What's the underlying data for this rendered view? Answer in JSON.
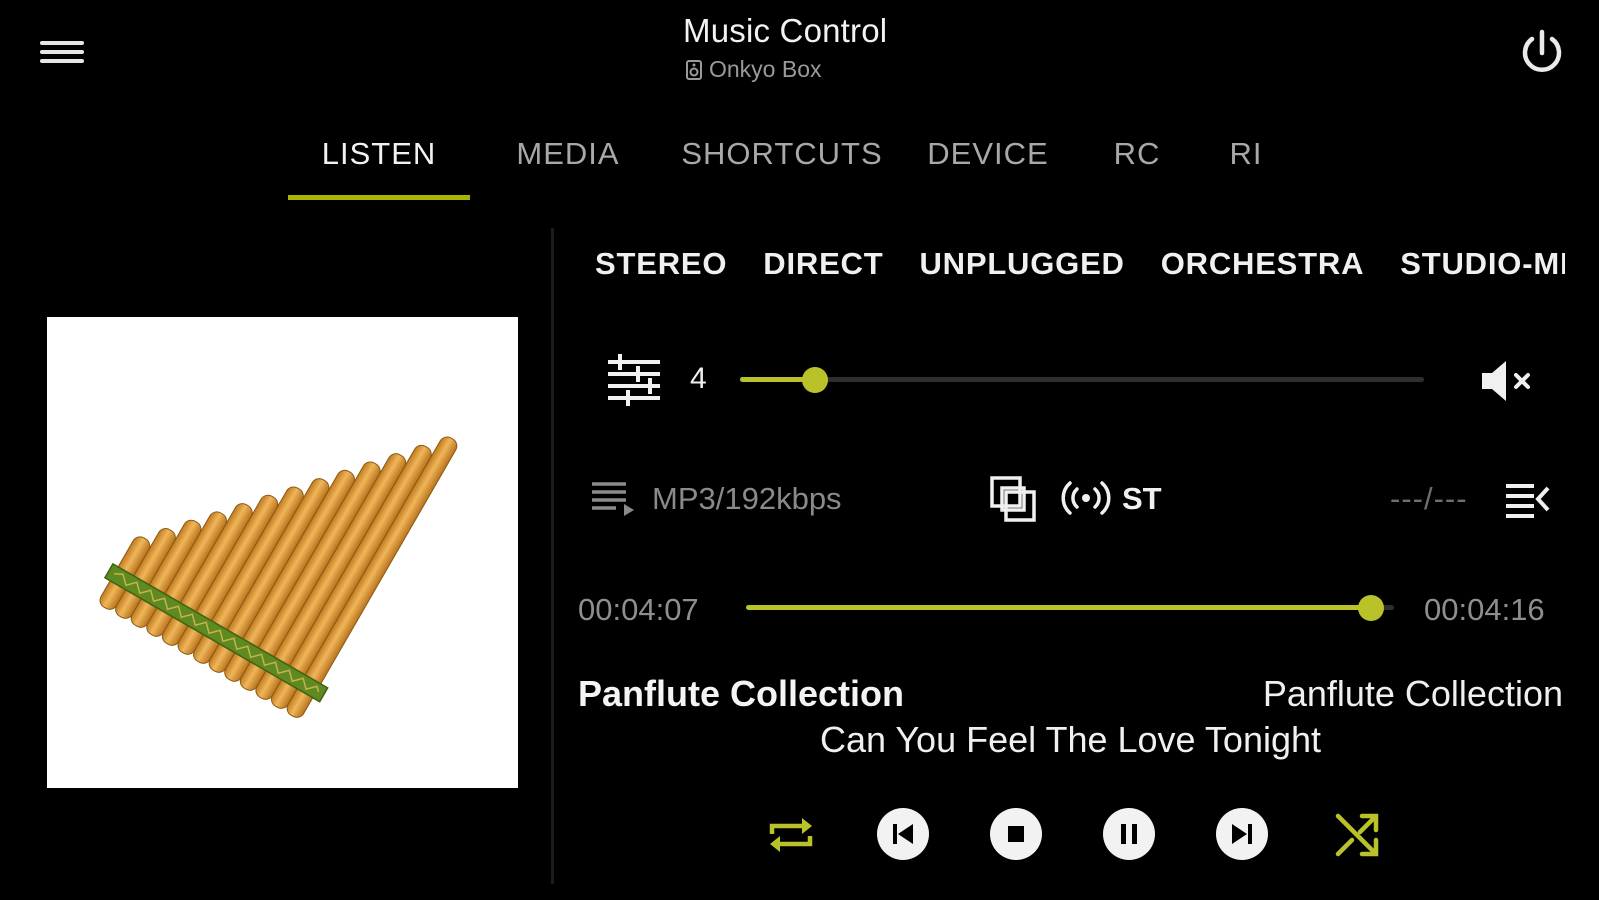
{
  "header": {
    "title": "Music Control",
    "device": "Onkyo Box"
  },
  "tabs": [
    {
      "label": "LISTEN",
      "active": true
    },
    {
      "label": "MEDIA",
      "active": false
    },
    {
      "label": "SHORTCUTS",
      "active": false
    },
    {
      "label": "DEVICE",
      "active": false
    },
    {
      "label": "RC",
      "active": false
    },
    {
      "label": "RI",
      "active": false
    }
  ],
  "listening_modes": [
    "STEREO",
    "DIRECT",
    "UNPLUGGED",
    "ORCHESTRA",
    "STUDIO-MI"
  ],
  "volume": {
    "value": "4",
    "level_fraction": 0.11,
    "muted": false
  },
  "info": {
    "format": "MP3/192kbps",
    "signal": "ST",
    "track_position": "---/---"
  },
  "playback": {
    "elapsed": "00:04:07",
    "total": "00:04:16",
    "progress_fraction": 0.965
  },
  "track": {
    "album": "Panflute Collection",
    "artist": "Panflute Collection",
    "title": "Can You Feel The Love Tonight"
  },
  "icons": {
    "menu": "menu-icon",
    "power": "power-icon",
    "equalizer": "equalizer-icon",
    "mute": "volume-mute-icon",
    "playlist": "playlist-icon",
    "fit": "screen-fit-icon",
    "radio": "radio-signal-icon",
    "queue": "queue-icon",
    "repeat": "repeat-icon",
    "previous": "skip-previous-icon",
    "stop": "stop-icon",
    "pause": "pause-icon",
    "next": "skip-next-icon",
    "shuffle": "shuffle-icon"
  },
  "colors": {
    "accent": "#b9c229",
    "background": "#000000",
    "tab_indicator": "#a8b400"
  }
}
